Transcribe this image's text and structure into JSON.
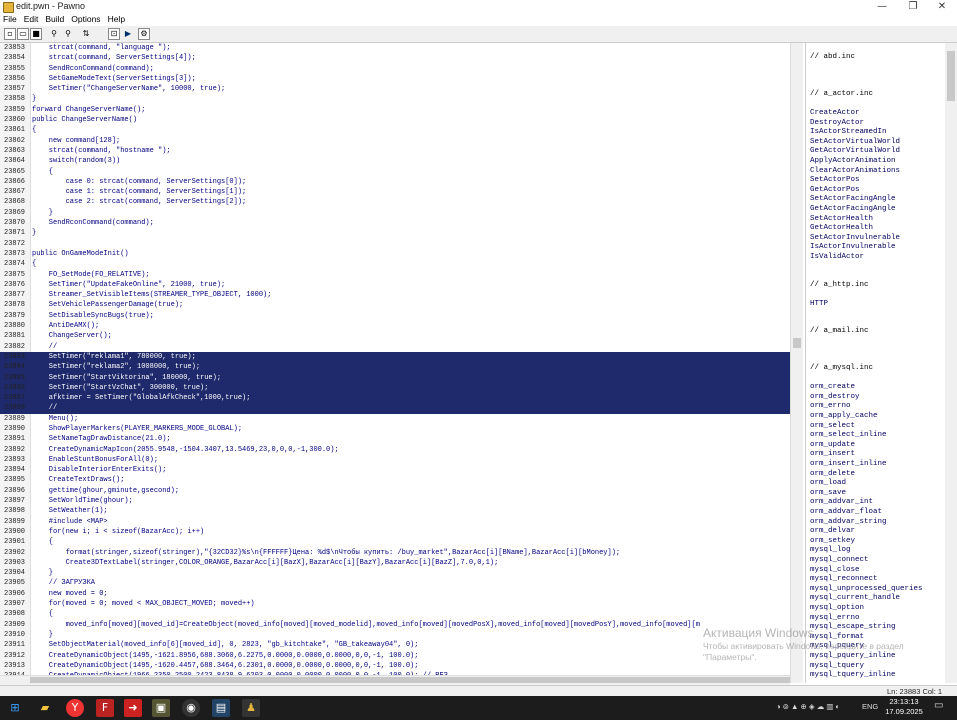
{
  "window": {
    "title": "edit.pwn - Pawno",
    "minimize": "—",
    "maximize": "❐",
    "close": "✕"
  },
  "menu": [
    "File",
    "Edit",
    "Build",
    "Options",
    "Help"
  ],
  "toolbar_icons": [
    "new-file-icon",
    "open-file-icon",
    "save-icon",
    "find-icon",
    "find-replace-icon",
    "compile-icon",
    "run-icon",
    "settings-icon"
  ],
  "code_lines": [
    {
      "n": "23853",
      "t": "    strcat(command, \"language \");",
      "sel": false
    },
    {
      "n": "23854",
      "t": "    strcat(command, ServerSettings[4]);",
      "sel": false
    },
    {
      "n": "23855",
      "t": "    SendRconCommand(command);",
      "sel": false
    },
    {
      "n": "23856",
      "t": "    SetGameModeText(ServerSettings[3]);",
      "sel": false
    },
    {
      "n": "23857",
      "t": "    SetTimer(\"ChangeServerName\", 10000, true);",
      "sel": false
    },
    {
      "n": "23858",
      "t": "}",
      "sel": false
    },
    {
      "n": "23859",
      "t": "forward ChangeServerName();",
      "sel": false
    },
    {
      "n": "23860",
      "t": "public ChangeServerName()",
      "sel": false
    },
    {
      "n": "23861",
      "t": "{",
      "sel": false
    },
    {
      "n": "23862",
      "t": "    new command[128];",
      "sel": false
    },
    {
      "n": "23863",
      "t": "    strcat(command, \"hostname \");",
      "sel": false
    },
    {
      "n": "23864",
      "t": "    switch(random(3))",
      "sel": false
    },
    {
      "n": "23865",
      "t": "    {",
      "sel": false
    },
    {
      "n": "23866",
      "t": "        case 0: strcat(command, ServerSettings[0]);",
      "sel": false
    },
    {
      "n": "23867",
      "t": "        case 1: strcat(command, ServerSettings[1]);",
      "sel": false
    },
    {
      "n": "23868",
      "t": "        case 2: strcat(command, ServerSettings[2]);",
      "sel": false
    },
    {
      "n": "23869",
      "t": "    }",
      "sel": false
    },
    {
      "n": "23870",
      "t": "    SendRconCommand(command);",
      "sel": false
    },
    {
      "n": "23871",
      "t": "}",
      "sel": false
    },
    {
      "n": "23872",
      "t": "",
      "sel": false
    },
    {
      "n": "23873",
      "t": "public OnGameModeInit()",
      "sel": false
    },
    {
      "n": "23874",
      "t": "{",
      "sel": false
    },
    {
      "n": "23875",
      "t": "    FO_SetMode(FO_RELATIVE);",
      "sel": false
    },
    {
      "n": "23876",
      "t": "    SetTimer(\"UpdateFakeOnline\", 21000, true);",
      "sel": false
    },
    {
      "n": "23877",
      "t": "    Streamer_SetVisibleItems(STREAMER_TYPE_OBJECT, 1000);",
      "sel": false
    },
    {
      "n": "23878",
      "t": "    SetVehiclePassengerDamage(true);",
      "sel": false
    },
    {
      "n": "23879",
      "t": "    SetDisableSyncBugs(true);",
      "sel": false
    },
    {
      "n": "23880",
      "t": "    AntiDeAMX();",
      "sel": false
    },
    {
      "n": "23881",
      "t": "    ChangeServer();",
      "sel": false
    },
    {
      "n": "23882",
      "t": "    //",
      "sel": false
    },
    {
      "n": "23883",
      "t": "    SetTimer(\"reklama1\", 780000, true);",
      "sel": true
    },
    {
      "n": "23884",
      "t": "    SetTimer(\"reklama2\", 1008000, true);",
      "sel": true
    },
    {
      "n": "23885",
      "t": "    SetTimer(\"StartViktorina\", 180000, true);",
      "sel": true
    },
    {
      "n": "23886",
      "t": "    SetTimer(\"StartVzChat\", 300000, true);",
      "sel": true
    },
    {
      "n": "23887",
      "t": "    afktimer = SetTimer(\"GlobalAfkCheck\",1000,true);",
      "sel": true
    },
    {
      "n": "23888",
      "t": "    //",
      "sel": true
    },
    {
      "n": "23889",
      "t": "    Menu();",
      "sel": false
    },
    {
      "n": "23890",
      "t": "    ShowPlayerMarkers(PLAYER_MARKERS_MODE_GLOBAL);",
      "sel": false
    },
    {
      "n": "23891",
      "t": "    SetNameTagDrawDistance(21.0);",
      "sel": false
    },
    {
      "n": "23892",
      "t": "    CreateDynamicMapIcon(2055.9548,-1504.3407,13.5469,23,0,0,0,-1,300.0);",
      "sel": false
    },
    {
      "n": "23893",
      "t": "    EnableStuntBonusForAll(0);",
      "sel": false
    },
    {
      "n": "23894",
      "t": "    DisableInteriorEnterExits();",
      "sel": false
    },
    {
      "n": "23895",
      "t": "    CreateTextDraws();",
      "sel": false
    },
    {
      "n": "23896",
      "t": "    gettime(ghour,gminute,gsecond);",
      "sel": false
    },
    {
      "n": "23897",
      "t": "    SetWorldTime(ghour);",
      "sel": false
    },
    {
      "n": "23898",
      "t": "    SetWeather(1);",
      "sel": false
    },
    {
      "n": "23899",
      "t": "    #include <MAP>",
      "sel": false
    },
    {
      "n": "23900",
      "t": "    for(new i; i < sizeof(BazarAcc); i++)",
      "sel": false
    },
    {
      "n": "23901",
      "t": "    {",
      "sel": false
    },
    {
      "n": "23902",
      "t": "        format(stringer,sizeof(stringer),\"{32CD32}%s\\n{FFFFFF}Цена: %d$\\nЧтобы купить: /buy_market\",BazarAcc[i][BName],BazarAcc[i][bMoney]);",
      "sel": false
    },
    {
      "n": "23903",
      "t": "        Create3DTextLabel(stringer,COLOR_ORANGE,BazarAcc[i][BazX],BazarAcc[i][BazY],BazarAcc[i][BazZ],7.0,0,1);",
      "sel": false
    },
    {
      "n": "23904",
      "t": "    }",
      "sel": false
    },
    {
      "n": "23905",
      "t": "    // ЗАГРУЗКА",
      "sel": false
    },
    {
      "n": "23906",
      "t": "    new moved = 0;",
      "sel": false
    },
    {
      "n": "23907",
      "t": "    for(moved = 0; moved < MAX_OBJECT_MOVED; moved++)",
      "sel": false
    },
    {
      "n": "23908",
      "t": "    {",
      "sel": false
    },
    {
      "n": "23909",
      "t": "        moved_info[moved][moved_id]=CreateObject(moved_info[moved][moved_modelid],moved_info[moved][movedPosX],moved_info[moved][movedPosY],moved_info[moved][m",
      "sel": false
    },
    {
      "n": "23910",
      "t": "    }",
      "sel": false
    },
    {
      "n": "23911",
      "t": "    SetObjectMaterial(moved_info[6][moved_id], 0, 2823, \"gb_kitchtake\", \"GB_takeaway04\", 0);",
      "sel": false
    },
    {
      "n": "23912",
      "t": "    CreateDynamicObject(1495,-1621.8956,688.3060,6.2275,0.0000,0.0000,0.0000,0,0,-1, 100.0);",
      "sel": false
    },
    {
      "n": "23913",
      "t": "    CreateDynamicObject(1495,-1620.4457,688.3464,6.2301,0.0000,0.0000,0.0000,0,0,-1, 100.0);",
      "sel": false
    },
    {
      "n": "23914",
      "t": "    CreateDynamicObject(1966,2350.2500,2423.8438,9.6203,0.0000,0.0000,0.0000,0,0,-1, 100.0); // ВЕЗ",
      "sel": false
    }
  ],
  "side_panel": {
    "sections": [
      {
        "header": "// abd.inc",
        "items": []
      },
      {
        "header": "// a_actor.inc",
        "items": [
          "CreateActor",
          "DestroyActor",
          "IsActorStreamedIn",
          "SetActorVirtualWorld",
          "GetActorVirtualWorld",
          "ApplyActorAnimation",
          "ClearActorAnimations",
          "SetActorPos",
          "GetActorPos",
          "SetActorFacingAngle",
          "GetActorFacingAngle",
          "SetActorHealth",
          "GetActorHealth",
          "SetActorInvulnerable",
          "IsActorInvulnerable",
          "IsValidActor"
        ]
      },
      {
        "header": "// a_http.inc",
        "items": [
          "HTTP"
        ]
      },
      {
        "header": "// a_mail.inc",
        "items": []
      },
      {
        "header": "// a_mysql.inc",
        "items": [
          "orm_create",
          "orm_destroy",
          "orm_errno",
          "orm_apply_cache",
          "orm_select",
          "orm_select_inline",
          "orm_update",
          "orm_insert",
          "orm_insert_inline",
          "orm_delete",
          "orm_load",
          "orm_save",
          "orm_addvar_int",
          "orm_addvar_float",
          "orm_addvar_string",
          "orm_delvar",
          "orm_setkey",
          "mysql_log",
          "mysql_connect",
          "mysql_close",
          "mysql_reconnect",
          "mysql_unprocessed_queries",
          "mysql_current_handle",
          "mysql_option",
          "mysql_errno",
          "mysql_escape_string",
          "mysql_format",
          "mysql_pquery",
          "mysql_pquery_inline",
          "mysql_tquery",
          "mysql_tquery_inline"
        ]
      }
    ]
  },
  "status": "Ln: 23883  Col: 1",
  "watermark": {
    "title": "Активация Windows",
    "text": "Чтобы активировать Windows, перейдите в раздел \"Параметры\"."
  },
  "taskbar": {
    "apps": [
      "windows-start-icon",
      "file-explorer-icon",
      "yandex-browser-icon",
      "filezilla-icon",
      "media-app-icon",
      "game-app-icon",
      "obs-icon",
      "task-app-icon",
      "pawno-icon"
    ],
    "lang": "ENG",
    "time": "23:13:13",
    "date": "17.09.2025"
  }
}
